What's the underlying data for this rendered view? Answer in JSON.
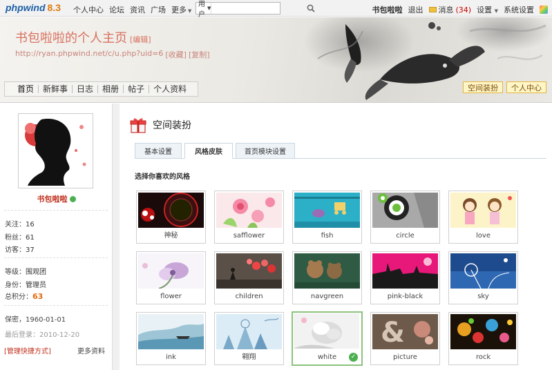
{
  "topbar": {
    "logo_text": "phpwind",
    "logo_version": "8.3",
    "nav": [
      {
        "label": "个人中心",
        "caret": false
      },
      {
        "label": "论坛",
        "caret": false
      },
      {
        "label": "资讯",
        "caret": false
      },
      {
        "label": "广场",
        "caret": false
      },
      {
        "label": "更多",
        "caret": true
      }
    ],
    "search_type": "用户",
    "search_placeholder": "",
    "username": "书包啦啦",
    "logout": "退出",
    "messages_label": "消息",
    "messages_count": "(34)",
    "settings": "设置",
    "system_settings": "系统设置"
  },
  "header": {
    "title": "书包啦啦的个人主页",
    "edit": "[编辑]",
    "url": "http://ryan.phpwind.net/c/u.php?uid=6",
    "bookmark": "[收藏]",
    "copy": "[复制]",
    "nav": [
      "首页",
      "新鲜事",
      "日志",
      "相册",
      "帖子",
      "个人资料"
    ],
    "btn_decorate": "空间装扮",
    "btn_center": "个人中心"
  },
  "sidebar": {
    "name": "书包啦啦",
    "follow_label": "关注：",
    "follow": "16",
    "fans_label": "粉丝：",
    "fans": "61",
    "visitors_label": "访客：",
    "visitors": "37",
    "level_label": "等级：",
    "level": "围观团",
    "identity_label": "身份：",
    "identity": "管理员",
    "points_label": "总积分：",
    "points": "63",
    "secret_label": "保密",
    "birthday": "，1960-01-01",
    "last_login_label": "最后登录：",
    "last_login": "2010-12-20",
    "manage_link": "[管理快捷方式]",
    "more_link": "更多资料"
  },
  "main": {
    "section_title": "空间装扮",
    "tabs": [
      "基本设置",
      "风格皮肤",
      "首页模块设置"
    ],
    "active_tab": 1,
    "choose_label": "选择你喜欢的风格",
    "selected_skin": "white",
    "skins": [
      {
        "label": "神秘"
      },
      {
        "label": "safflower"
      },
      {
        "label": "fish"
      },
      {
        "label": "circle"
      },
      {
        "label": "love"
      },
      {
        "label": "flower"
      },
      {
        "label": "children"
      },
      {
        "label": "navgreen"
      },
      {
        "label": "pink-black"
      },
      {
        "label": "sky"
      },
      {
        "label": "ink"
      },
      {
        "label": "翱翔"
      },
      {
        "label": "white"
      },
      {
        "label": "picture"
      },
      {
        "label": "rock"
      }
    ]
  },
  "colors": {
    "accent_red": "#c0301d",
    "title_salmon": "#d9705f",
    "highlight_orange": "#e06a10",
    "selected_green": "#4caf50"
  }
}
